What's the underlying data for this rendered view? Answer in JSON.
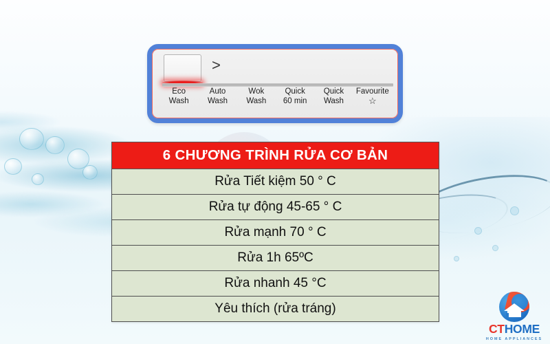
{
  "colors": {
    "panel_border_blue": "#5181d8",
    "panel_inner_red": "#ef6a60",
    "indicator_red": "#ed2323",
    "table_header_red": "#ed1c16",
    "table_cell_green": "#dde6d1",
    "table_border_gray": "#4e4e4e",
    "logo_red": "#e8342a",
    "logo_blue": "#1f6fc4",
    "background_blue": "#e9f5fa"
  },
  "control_panel": {
    "selected_program": "Eco Wash",
    "next_icon": ">",
    "programs": [
      {
        "line1": "Eco",
        "line2": "Wash",
        "star": ""
      },
      {
        "line1": "Auto",
        "line2": "Wash",
        "star": ""
      },
      {
        "line1": "Wok",
        "line2": "Wash",
        "star": ""
      },
      {
        "line1": "Quick",
        "line2": "60 min",
        "star": ""
      },
      {
        "line1": "Quick",
        "line2": "Wash",
        "star": ""
      },
      {
        "line1": "Favourite",
        "line2": "",
        "star": "☆"
      }
    ]
  },
  "table": {
    "header": "6 CHƯƠNG TRÌNH RỬA CƠ BẢN",
    "rows": [
      "Rửa Tiết kiệm 50 ° C",
      "Rửa tự động 45-65 ° C",
      "Rửa mạnh 70 ° C",
      "Rửa 1h 65ºC",
      "Rửa nhanh 45 °C",
      "Yêu thích (rửa tráng)"
    ]
  },
  "watermark": {
    "brand_ct": "CT",
    "brand_home": "HOME",
    "tagline": "HOME APPLIANCES"
  },
  "logo": {
    "brand_ct": "CT",
    "brand_home": "HOME",
    "tagline": "HOME APPLIANCES"
  }
}
